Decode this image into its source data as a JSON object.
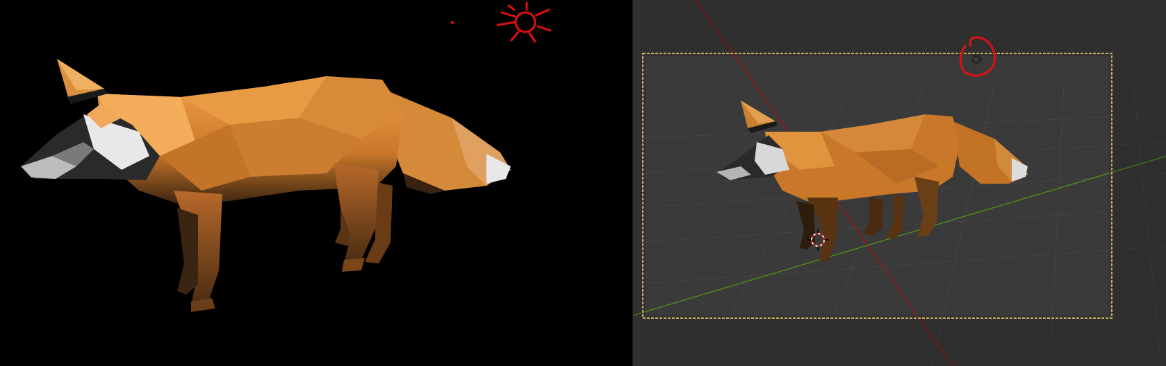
{
  "panels": {
    "render": {
      "caption": ""
    },
    "viewport": {
      "caption": ""
    }
  },
  "colors": {
    "render_background": "#000000",
    "viewport_background": "#3a3a3a",
    "fox_orange": "#d9822b",
    "fox_white": "#d0d0d0",
    "fox_dark": "#1a1a1a",
    "annotation_red": "#e01010",
    "axis_x_red": "#a01818",
    "axis_y_green": "#4f8a1c",
    "camera_frame": "#c8a85a"
  },
  "icons": {
    "sun_doodle": "sun-icon",
    "light_gizmo": "light-icon",
    "cursor_3d": "crosshair-icon"
  }
}
